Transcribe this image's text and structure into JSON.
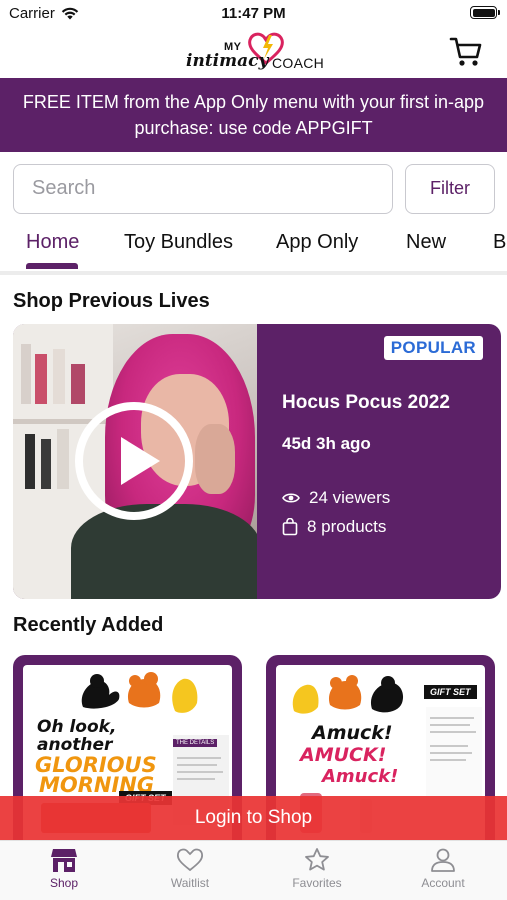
{
  "status_bar": {
    "carrier": "Carrier",
    "time": "11:47 PM"
  },
  "header": {
    "logo": {
      "my": "MY",
      "intimacy": "intimacy",
      "coach": "COACH"
    }
  },
  "promo": {
    "text": "FREE ITEM from the App Only menu with your first in-app purchase: use code APPGIFT"
  },
  "search": {
    "placeholder": "Search",
    "filter_label": "Filter"
  },
  "tabs": [
    {
      "label": "Home",
      "active": true
    },
    {
      "label": "Toy Bundles",
      "active": false
    },
    {
      "label": "App Only",
      "active": false
    },
    {
      "label": "New",
      "active": false
    },
    {
      "label": "Be",
      "active": false
    }
  ],
  "sections": {
    "previous_lives": "Shop Previous Lives",
    "recently_added": "Recently Added"
  },
  "live_card": {
    "badge": "POPULAR",
    "title": "Hocus Pocus 2022",
    "time_ago": "45d 3h ago",
    "viewers": "24 viewers",
    "products": "8 products"
  },
  "products": [
    {
      "line1": "Oh look,",
      "line2": "another",
      "line3": "GLORIOUS",
      "line4": "MORNING",
      "tag": "GIFT SET",
      "details": "THE DETAILS"
    },
    {
      "line1": "Amuck!",
      "line2": "AMUCK!",
      "line3": "Amuck!",
      "tag": "GIFT SET"
    }
  ],
  "login_banner": "Login to Shop",
  "tabbar": [
    {
      "label": "Shop",
      "icon": "shop-icon",
      "active": true
    },
    {
      "label": "Waitlist",
      "icon": "heart-icon",
      "active": false
    },
    {
      "label": "Favorites",
      "icon": "star-icon",
      "active": false
    },
    {
      "label": "Account",
      "icon": "person-icon",
      "active": false
    }
  ],
  "colors": {
    "brand_purple": "#5c2167",
    "login_red": "#e93434",
    "badge_blue": "#2b6bd6"
  }
}
